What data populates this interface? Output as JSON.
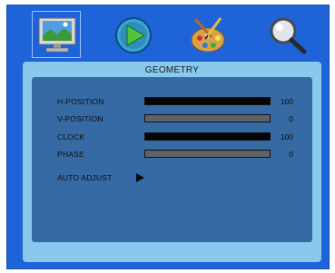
{
  "menu": {
    "tabs": [
      {
        "icon": "monitor-icon",
        "active": true
      },
      {
        "icon": "play-icon",
        "active": false
      },
      {
        "icon": "palette-icon",
        "active": false
      },
      {
        "icon": "magnifier-icon",
        "active": false
      }
    ]
  },
  "panel": {
    "title": "GEOMETRY",
    "rows": [
      {
        "label": "H-POSITION",
        "value": "100",
        "level": 1.0
      },
      {
        "label": "V-POSITION",
        "value": "0",
        "level": 0.0
      },
      {
        "label": "CLOCK",
        "value": "100",
        "level": 1.0
      },
      {
        "label": "PHASE",
        "value": "0",
        "level": 0.0
      }
    ],
    "auto_adjust": {
      "label": "AUTO ADJUST",
      "icon": "play-arrow-icon"
    }
  },
  "colors": {
    "osd_background": "#1f63d8",
    "panel_background": "#89c9ee",
    "inner_background": "#356aa4",
    "bar_empty": "#5f6266",
    "bar_fill": "#050505"
  }
}
